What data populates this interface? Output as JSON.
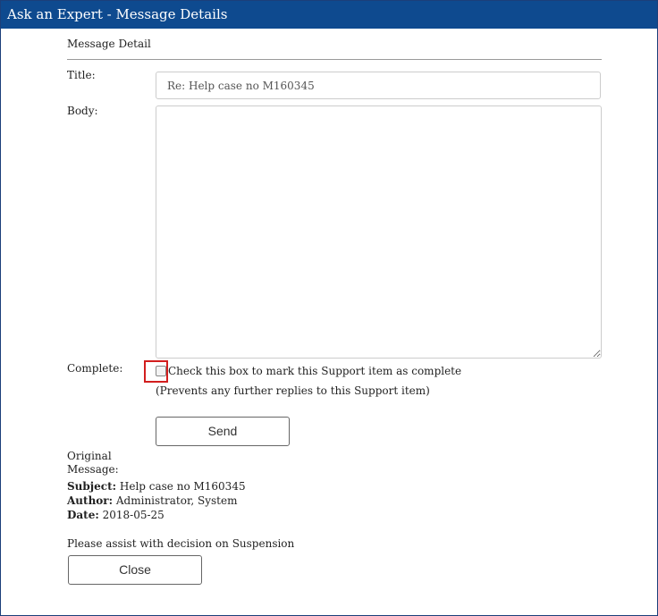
{
  "window": {
    "title": "Ask an Expert - Message Details"
  },
  "form": {
    "section_title": "Message Detail",
    "title_label": "Title:",
    "title_value": "Re: Help case no M160345",
    "body_label": "Body:",
    "body_value": "",
    "complete_label": "Complete:",
    "complete_checked": false,
    "complete_text": "Check this box to mark this Support item as complete",
    "complete_subtext": "(Prevents any further replies to this Support item)",
    "send_label": "Send"
  },
  "original": {
    "label": "Original Message:",
    "subject_label": "Subject:",
    "subject_value": "Help case no M160345",
    "author_label": "Author:",
    "author_value": "Administrator, System",
    "date_label": "Date:",
    "date_value": "2018-05-25",
    "message": "Please assist with decision on Suspension"
  },
  "close_label": "Close",
  "colors": {
    "titlebar": "#0e4a8f",
    "highlight": "#d21e1e"
  }
}
